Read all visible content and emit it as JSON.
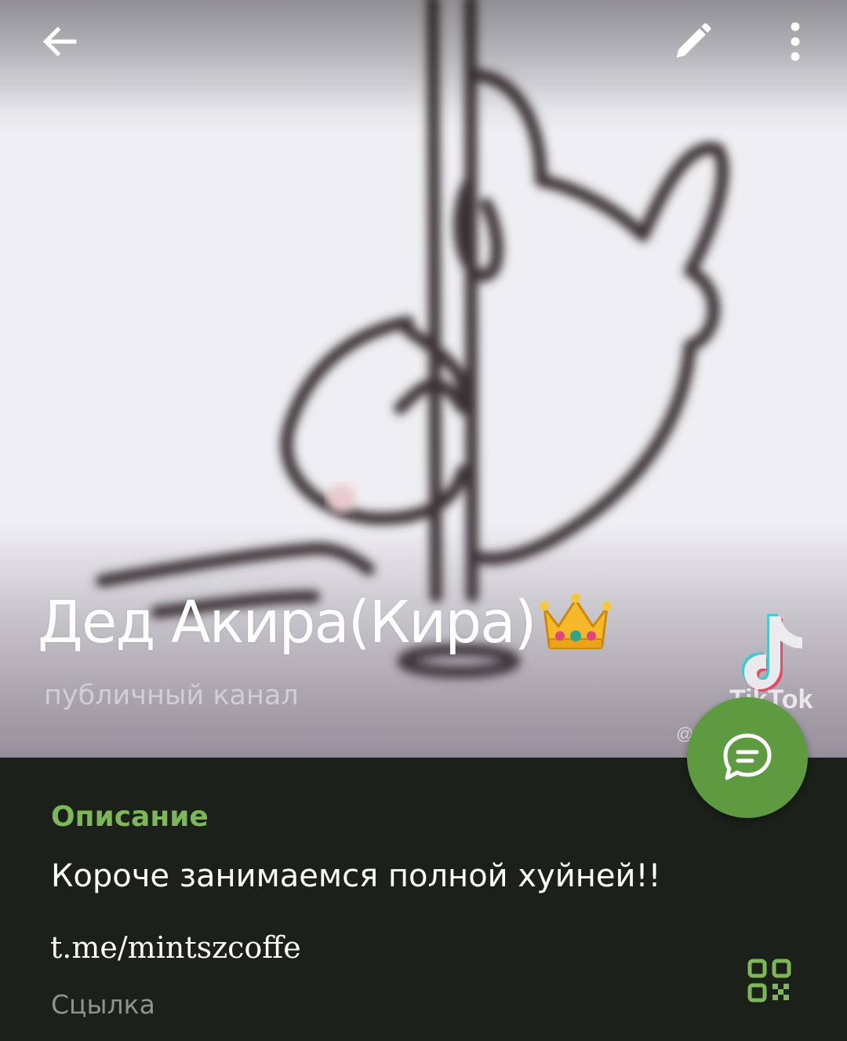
{
  "header": {
    "channel_name": "Дед Акира(Кира)",
    "channel_type": "публичный канал",
    "watermark_text": "TikTok",
    "watermark_handle": "@...892"
  },
  "top_bar": {
    "back_icon": "arrow-left-icon",
    "edit_icon": "pencil-icon",
    "more_icon": "more-vertical-icon"
  },
  "fab": {
    "icon": "message-bubble-icon",
    "color": "#5e9a3f"
  },
  "info": {
    "section_title": "Описание",
    "description": "Короче занимаемся полной хуйней!!",
    "link": "t.me/mintszcoffe",
    "link_caption": "Сцылка",
    "qr_icon": "qr-code-icon"
  },
  "colors": {
    "accent": "#7db75a",
    "background": "#1b2119",
    "fab": "#5e9a3f",
    "secondary_text": "#8e948c"
  }
}
